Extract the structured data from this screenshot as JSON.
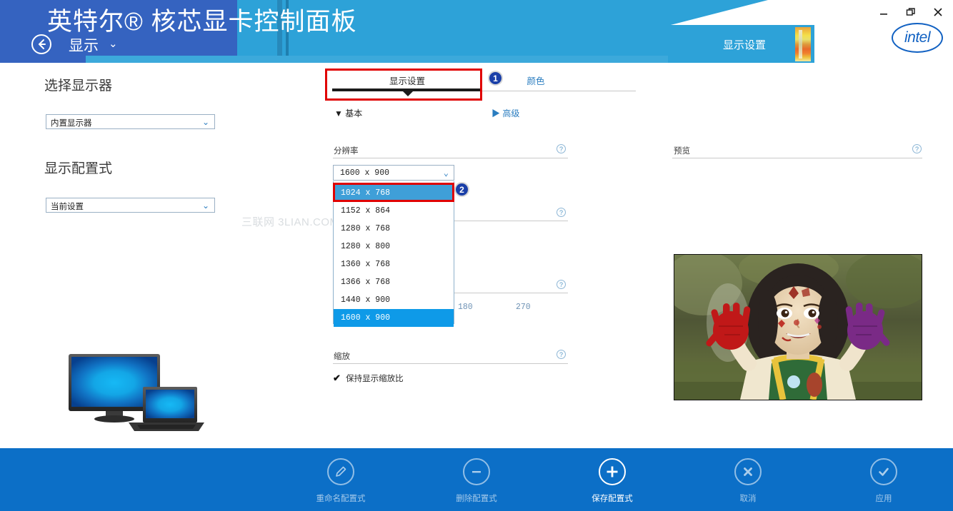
{
  "window": {
    "app_title": "英特尔® 核芯显卡控制面板",
    "nav_label": "显示",
    "nav_chevron": "⌄",
    "breadcrumb_right": "显示设置",
    "brand": "intel",
    "minimize": "—",
    "restore": "❐",
    "close": "✕"
  },
  "sidebar": {
    "select_display_heading": "选择显示器",
    "select_display_value": "内置显示器",
    "display_profile_heading": "显示配置式",
    "display_profile_value": "当前设置",
    "caret": "⌄"
  },
  "watermark": "三联网 3LIAN.COM",
  "tabs": {
    "active": "显示设置",
    "inactive": "颜色",
    "marker_1": "1"
  },
  "subtabs": {
    "basic": "▼ 基本",
    "advanced": "▶ 高级"
  },
  "fields": {
    "resolution_label": "分辨率",
    "resolution_value": "1600 x 900",
    "scaling_label": "缩放",
    "keep_aspect_label": "保持显示缩放比",
    "keep_aspect_check": "✔",
    "help": "?"
  },
  "resolution_dropdown": {
    "marker_2": "2",
    "options": [
      {
        "label": "1024 x 768",
        "state": "hover"
      },
      {
        "label": "1152 x 864",
        "state": "normal"
      },
      {
        "label": "1280 x 768",
        "state": "normal"
      },
      {
        "label": "1280 x 800",
        "state": "normal"
      },
      {
        "label": "1360 x 768",
        "state": "normal"
      },
      {
        "label": "1366 x 768",
        "state": "normal"
      },
      {
        "label": "1440 x 900",
        "state": "normal"
      },
      {
        "label": "1600 x 900",
        "state": "selected"
      }
    ]
  },
  "hidden_rotation": {
    "value_180": "180",
    "value_270": "270"
  },
  "preview": {
    "label": "预览"
  },
  "toolbar": {
    "buttons": [
      {
        "label": "重命名配置式",
        "icon": "pencil-icon",
        "enabled": false
      },
      {
        "label": "删除配置式",
        "icon": "minus-icon",
        "enabled": false
      },
      {
        "label": "保存配置式",
        "icon": "plus-icon",
        "enabled": true
      },
      {
        "label": "取消",
        "icon": "close-icon",
        "enabled": false
      },
      {
        "label": "应用",
        "icon": "check-icon",
        "enabled": false
      }
    ]
  },
  "colors": {
    "header_blue": "#2da2d8",
    "header_dark_blue": "#3563c0",
    "bottom_bar_blue": "#0c6fc7",
    "accent_link": "#2a7dc0",
    "highlight_red": "#e00000",
    "selected_blue": "#0e9ae8"
  }
}
